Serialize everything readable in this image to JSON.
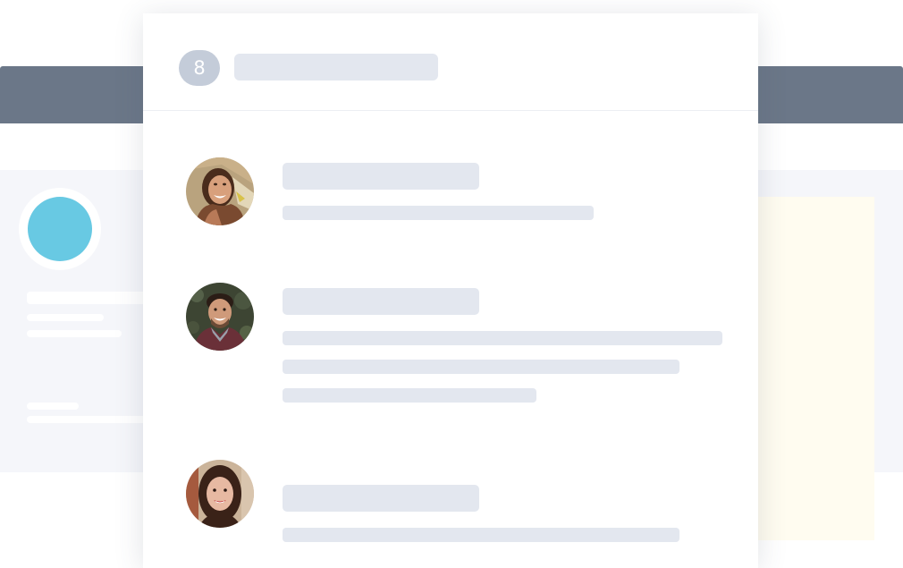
{
  "background": {
    "header_color": "#6b7788",
    "profile_avatar_color": "#68c9e3"
  },
  "card": {
    "unread_count": "8",
    "badge_color": "#c4ccd9",
    "placeholder_color": "#e3e7ef"
  },
  "messages": [
    {
      "avatar": "smiling-woman-avatar",
      "body_lines": 1
    },
    {
      "avatar": "smiling-man-avatar",
      "body_lines": 3
    },
    {
      "avatar": "woman-dark-hair-avatar",
      "body_lines": 1
    }
  ]
}
